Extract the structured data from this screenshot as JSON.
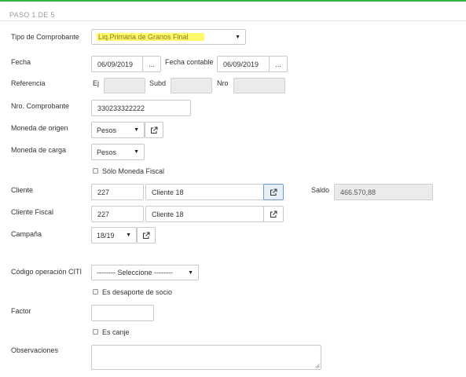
{
  "step": {
    "title": "PASO 1 DE 5"
  },
  "colors": {
    "accent_top": "#2db63e",
    "highlight": "#fff86a"
  },
  "fields": {
    "tipo_comprobante": {
      "label": "Tipo de Comprobante",
      "value": "Liq.Primaria de Granos Final"
    },
    "fecha": {
      "label": "Fecha",
      "value": "06/09/2019",
      "picker": "..."
    },
    "fecha_contable": {
      "label": "Fecha contable",
      "value": "06/09/2019",
      "picker": "..."
    },
    "referencia": {
      "label": "Referencia",
      "ej_label": "Ej",
      "ej_value": "",
      "subd_label": "Subd",
      "subd_value": "",
      "nro_label": "Nro",
      "nro_value": ""
    },
    "nro_comprobante": {
      "label": "Nro. Comprobante",
      "value": "330233322222"
    },
    "moneda_origen": {
      "label": "Moneda de origen",
      "value": "Pesos"
    },
    "moneda_carga": {
      "label": "Moneda de carga",
      "value": "Pesos"
    },
    "solo_moneda_fiscal": {
      "label": "Sólo Moneda Fiscal",
      "checked": false
    },
    "cliente": {
      "label": "Cliente",
      "code": "227",
      "name": "Cliente 18"
    },
    "saldo": {
      "label": "Saldo",
      "value": "466.570,88"
    },
    "cliente_fiscal": {
      "label": "Cliente Fiscal",
      "code": "227",
      "name": "Cliente 18"
    },
    "campana": {
      "label": "Campaña",
      "value": "18/19"
    },
    "codigo_operacion_citi": {
      "label": "Código operación CITI",
      "value": "-------- Seleccione --------"
    },
    "es_desaporte_socio": {
      "label": "Es desaporte de socio",
      "checked": false
    },
    "factor": {
      "label": "Factor",
      "value": ""
    },
    "es_canje": {
      "label": "Es canje",
      "checked": false
    },
    "observaciones": {
      "label": "Observaciones",
      "value": ""
    }
  },
  "icons": {
    "external_link": "external-link-icon",
    "caret": "caret-down-icon",
    "resize": "resize-grip-icon"
  }
}
